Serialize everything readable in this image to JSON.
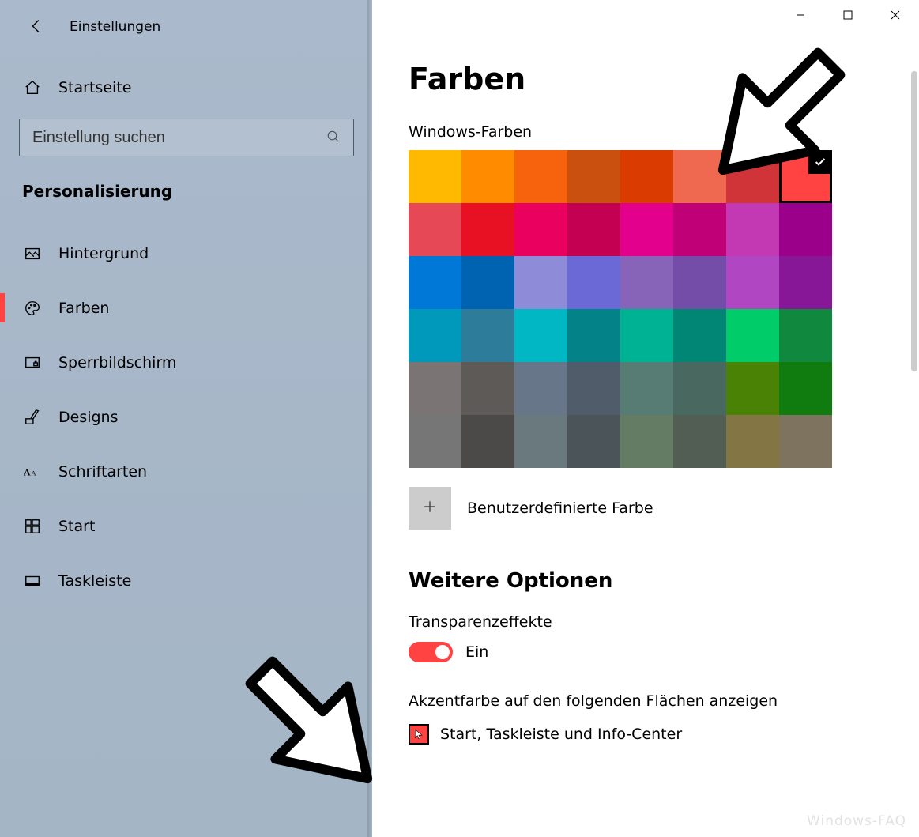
{
  "header": {
    "title": "Einstellungen"
  },
  "sidebar": {
    "home_label": "Startseite",
    "search_placeholder": "Einstellung suchen",
    "category_label": "Personalisierung",
    "items": [
      {
        "label": "Hintergrund",
        "icon": "picture-icon",
        "active": false
      },
      {
        "label": "Farben",
        "icon": "palette-icon",
        "active": true
      },
      {
        "label": "Sperrbildschirm",
        "icon": "lockscreen-icon",
        "active": false
      },
      {
        "label": "Designs",
        "icon": "designs-icon",
        "active": false
      },
      {
        "label": "Schriftarten",
        "icon": "fonts-icon",
        "active": false
      },
      {
        "label": "Start",
        "icon": "start-icon",
        "active": false
      },
      {
        "label": "Taskleiste",
        "icon": "taskbar-icon",
        "active": false
      }
    ]
  },
  "main": {
    "page_title": "Farben",
    "palette_label": "Windows-Farben",
    "palette": [
      [
        "#ffb900",
        "#ff8c00",
        "#f7630c",
        "#ca5010",
        "#da3b01",
        "#ef6950",
        "#d13438",
        "#ff4343"
      ],
      [
        "#e74856",
        "#e81123",
        "#ea005e",
        "#c30052",
        "#e3008c",
        "#bf0077",
        "#c239b3",
        "#9a0089"
      ],
      [
        "#0078d7",
        "#0063b1",
        "#8e8cd8",
        "#6b69d6",
        "#8764b8",
        "#744da9",
        "#b146c2",
        "#881798"
      ],
      [
        "#0099bc",
        "#2d7d9a",
        "#00b7c3",
        "#038387",
        "#00b294",
        "#018574",
        "#00cc6a",
        "#10893e"
      ],
      [
        "#7a7574",
        "#5d5a58",
        "#68768a",
        "#515c6b",
        "#567c73",
        "#486860",
        "#498205",
        "#107c10"
      ],
      [
        "#767676",
        "#4c4a48",
        "#69797e",
        "#4a5459",
        "#647c64",
        "#525e54",
        "#847545",
        "#7e735f"
      ]
    ],
    "selected_swatch": "0.7",
    "custom_color_label": "Benutzerdefinierte Farbe",
    "more_options_title": "Weitere Optionen",
    "transparency": {
      "label": "Transparenzeffekte",
      "state_label": "Ein",
      "on": true
    },
    "accent_surfaces": {
      "label": "Akzentfarbe auf den folgenden Flächen anzeigen",
      "options": [
        {
          "label": "Start, Taskleiste und Info-Center",
          "checked": true
        }
      ]
    }
  },
  "watermark": "Windows-FAQ",
  "accent_color": "#ff4343"
}
